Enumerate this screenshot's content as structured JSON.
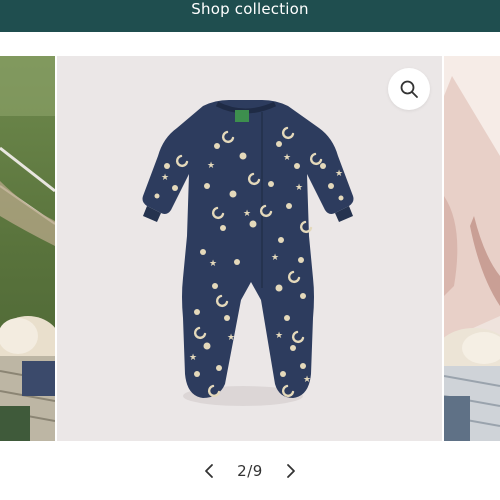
{
  "banner": {
    "button_label": "Shop collection"
  },
  "gallery": {
    "main_image_alt": "Navy footed sleepsuit with cream moon and star print",
    "zoom_icon": "search-icon",
    "pager": {
      "current": 2,
      "total": 9,
      "label": "2/9",
      "prev_icon": "chevron-left-icon",
      "next_icon": "chevron-right-icon"
    }
  },
  "colors": {
    "banner_bg": "#1f4e4f",
    "main_slide_bg": "#ebe7e7",
    "garment": "#2d3c5e",
    "print": "#e4d9bb"
  }
}
